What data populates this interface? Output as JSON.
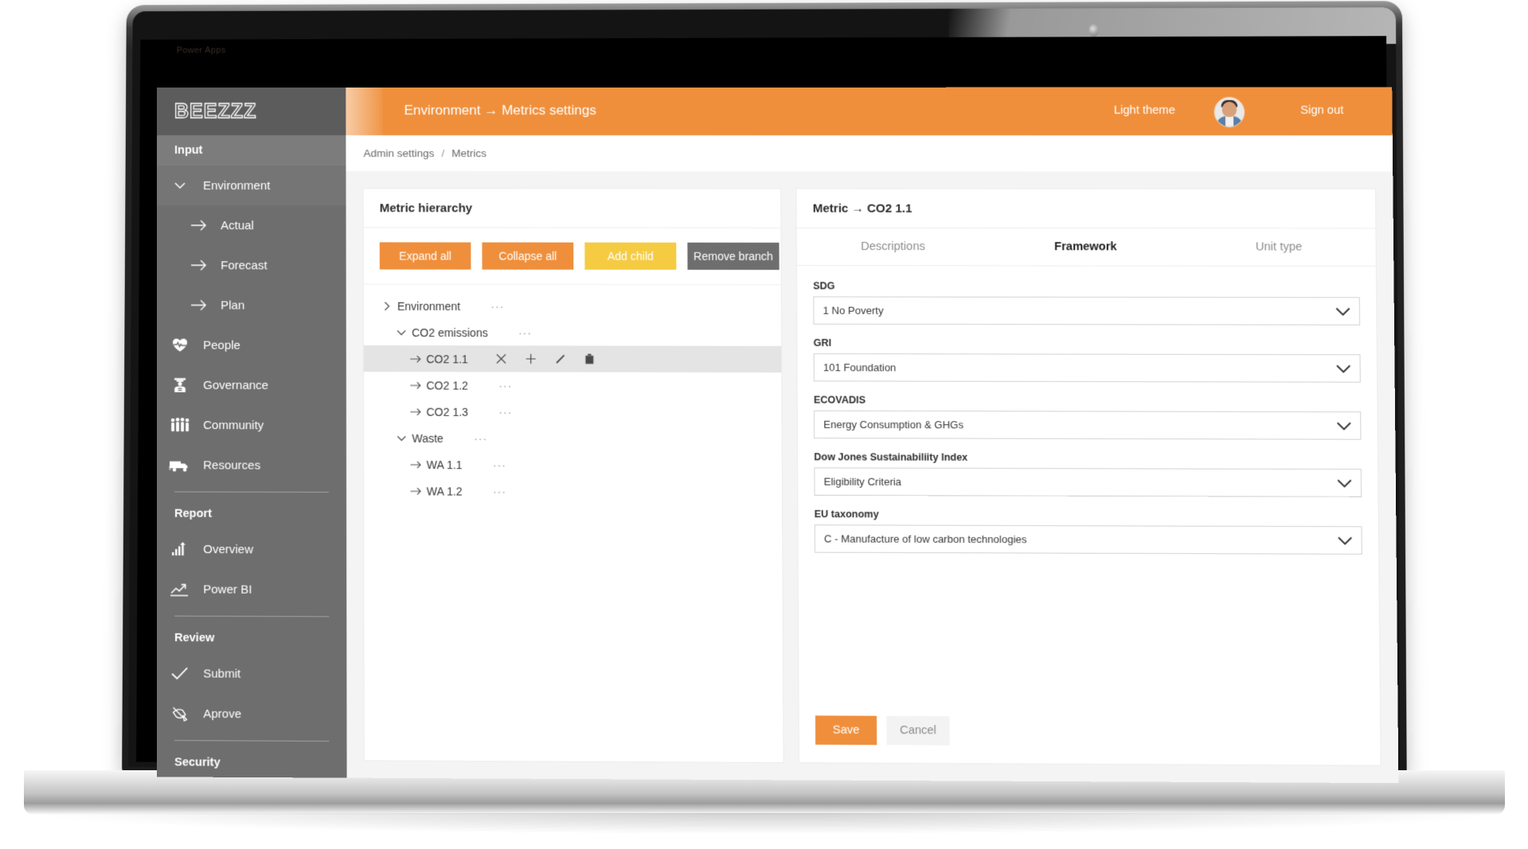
{
  "browser": {
    "tab_title": "Power Apps"
  },
  "brand": {
    "name": "BEEZZZ"
  },
  "topbar": {
    "title": "Environment → Metrics settings",
    "light_theme": "Light theme",
    "sign_out": "Sign out",
    "accent_color": "#ef8f3c"
  },
  "breadcrumb": {
    "root": "Admin settings",
    "separator": "/",
    "current": "Metrics"
  },
  "sidebar": {
    "sections": [
      {
        "label": "Input"
      },
      {
        "label": "Report"
      },
      {
        "label": "Review"
      },
      {
        "label": "Security"
      }
    ],
    "input_items": [
      {
        "label": "Environment",
        "icon": "chevron-down-icon"
      },
      {
        "label": "Actual",
        "icon": "arrow-right-icon"
      },
      {
        "label": "Forecast",
        "icon": "arrow-right-icon"
      },
      {
        "label": "Plan",
        "icon": "arrow-right-icon"
      }
    ],
    "pillars": [
      {
        "label": "People",
        "icon": "heartbeat-icon"
      },
      {
        "label": "Governance",
        "icon": "officer-icon"
      },
      {
        "label": "Community",
        "icon": "people-group-icon"
      },
      {
        "label": "Resources",
        "icon": "truck-icon"
      }
    ],
    "report_items": [
      {
        "label": "Overview",
        "icon": "bar-chart-icon"
      },
      {
        "label": "Power BI",
        "icon": "line-chart-icon"
      }
    ],
    "review_items": [
      {
        "label": "Submit",
        "icon": "check-icon"
      },
      {
        "label": "Aprove",
        "icon": "stamp-icon"
      }
    ]
  },
  "hierarchy": {
    "title": "Metric hierarchy",
    "buttons": {
      "expand_all": "Expand all",
      "collapse_all": "Collapse all",
      "add_child": "Add child",
      "remove_branch": "Remove branch"
    },
    "row_action_icons": [
      "close-icon",
      "plus-icon",
      "pencil-icon",
      "trash-icon"
    ],
    "overflow_glyph": "···",
    "nodes": [
      {
        "label": "Environment",
        "level": 0,
        "twisty": "chevron-right-icon",
        "selected": false
      },
      {
        "label": "CO2 emissions",
        "level": 1,
        "twisty": "chevron-down-icon",
        "selected": false
      },
      {
        "label": "CO2 1.1",
        "level": 2,
        "twisty": "arrow-right-icon",
        "selected": true
      },
      {
        "label": "CO2 1.2",
        "level": 2,
        "twisty": "arrow-right-icon",
        "selected": false
      },
      {
        "label": "CO2 1.3",
        "level": 2,
        "twisty": "arrow-right-icon",
        "selected": false
      },
      {
        "label": "Waste",
        "level": 1,
        "twisty": "chevron-down-icon",
        "selected": false
      },
      {
        "label": "WA 1.1",
        "level": 2,
        "twisty": "arrow-right-icon",
        "selected": false
      },
      {
        "label": "WA 1.2",
        "level": 2,
        "twisty": "arrow-right-icon",
        "selected": false
      }
    ]
  },
  "detail": {
    "title": "Metric → CO2 1.1",
    "tabs": [
      {
        "label": "Descriptions",
        "active": false
      },
      {
        "label": "Framework",
        "active": true
      },
      {
        "label": "Unit type",
        "active": false
      }
    ],
    "fields": [
      {
        "label": "SDG",
        "value": "1 No Poverty"
      },
      {
        "label": "GRI",
        "value": "101 Foundation"
      },
      {
        "label": "ECOVADIS",
        "value": "Energy Consumption & GHGs"
      },
      {
        "label": "Dow Jones Sustainabiliity Index",
        "value": "Eligibility Criteria"
      },
      {
        "label": "EU taxonomy",
        "value": "C - Manufacture of low carbon technologies"
      }
    ],
    "save_label": "Save",
    "cancel_label": "Cancel"
  }
}
